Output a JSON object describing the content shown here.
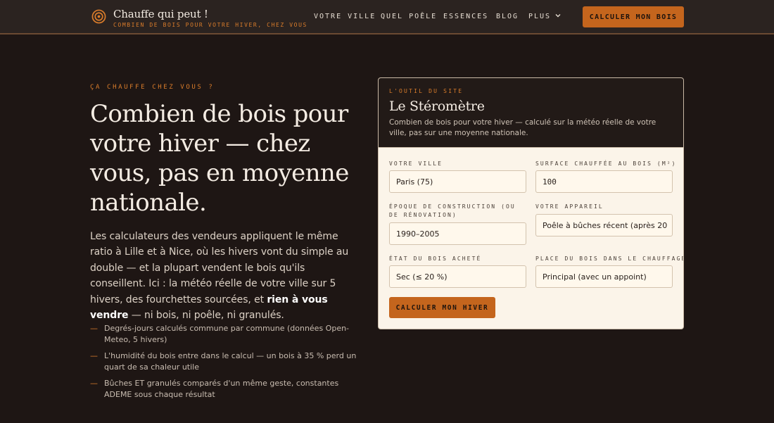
{
  "header": {
    "brand_name": "Chauffe qui peut !",
    "tagline": "COMBIEN DE BOIS POUR VOTRE HIVER, CHEZ VOUS",
    "logo_icon": "flame-target-icon",
    "nav": [
      "VOTRE VILLE",
      "QUEL POÊLE",
      "ESSENCES",
      "BLOG",
      "PLUS"
    ],
    "cta": "CALCULER MON BOIS"
  },
  "hero": {
    "eyebrow": "ÇA CHAUFFE CHEZ VOUS ?",
    "title": "Combien de bois pour votre hiver — chez vous, pas en moyenne nationale.",
    "text_before": "Les calculateurs des vendeurs appliquent le même ratio à Lille et à Nice, où les hivers vont du simple au double — et la plupart vendent le bois qu'ils conseillent. Ici : la météo réelle de votre ville sur 5 hivers, des fourchettes sourcées, et ",
    "text_strong": "rien à vous vendre",
    "text_after": " — ni bois, ni poêle, ni granulés.",
    "bullet_marker": "—",
    "bullets": [
      "Degrés-jours calculés commune par commune (données Open-Meteo, 5 hivers)",
      "L'humidité du bois entre dans le calcul — un bois à 35 % perd un quart de sa chaleur utile",
      "Bûches ET granulés comparés d'un même geste, constantes ADEME sous chaque résultat"
    ]
  },
  "tool": {
    "eyebrow": "L'OUTIL DU SITE",
    "title": "Le Stéromètre",
    "description": "Combien de bois pour votre hiver — calculé sur la météo réelle de votre ville, pas sur une moyenne nationale.",
    "fields": {
      "city": {
        "label": "VOTRE VILLE",
        "value": "Paris (75)"
      },
      "surface": {
        "label": "SURFACE CHAUFFÉE AU BOIS (M²)",
        "value": "100"
      },
      "era": {
        "label": "ÉPOQUE DE CONSTRUCTION (OU DE RÉNOVATION)",
        "value": "1990–2005"
      },
      "device": {
        "label": "VOTRE APPAREIL",
        "value": "Poêle à bûches récent (après 20"
      },
      "wood_state": {
        "label": "ÉTAT DU BOIS ACHETÉ",
        "value": "Sec (≤ 20 %)"
      },
      "wood_role": {
        "label": "PLACE DU BOIS DANS LE CHAUFFAGE",
        "value": "Principal (avec un appoint)"
      }
    },
    "submit": "CALCULER MON HIVER"
  },
  "colors": {
    "background": "#1e1614",
    "header_bg": "#2b2320",
    "accent": "#c4651d",
    "accent_text": "#d97c2b",
    "card_bg": "#fbf4e9"
  }
}
